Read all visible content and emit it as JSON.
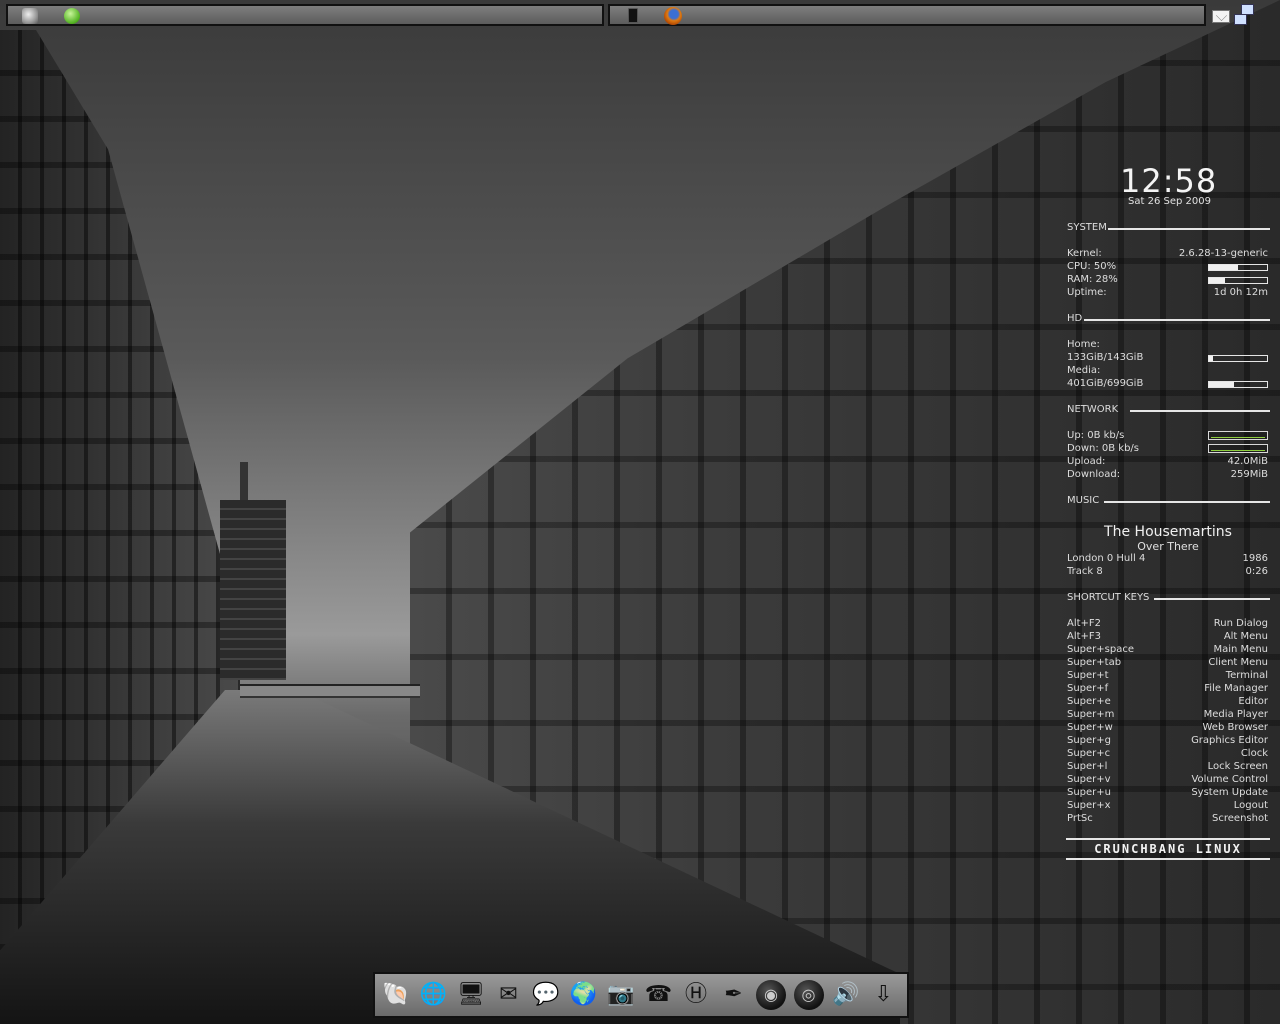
{
  "conky": {
    "clock": "12:58",
    "date": "Sat 26 Sep 2009",
    "system": {
      "header": "SYSTEM",
      "kernel_label": "Kernel:",
      "kernel_value": "2.6.28-13-generic",
      "cpu_label": "CPU: 50%",
      "cpu_fraction": 0.5,
      "ram_label": "RAM: 28%",
      "ram_fraction": 0.28,
      "uptime_label": "Uptime:",
      "uptime_value": "1d 0h 12m"
    },
    "hd": {
      "header": "HD",
      "home_label": "Home:",
      "home_usage": "133GiB/143GiB",
      "home_fraction": 0.07,
      "media_label": "Media:",
      "media_usage": "401GiB/699GiB",
      "media_fraction": 0.43
    },
    "network": {
      "header": "NETWORK",
      "up_label": "Up: 0B  kb/s",
      "down_label": "Down: 0B  kb/s",
      "upload_label": "Upload:",
      "upload_value": "42.0MiB",
      "download_label": "Download:",
      "download_value": "259MiB"
    },
    "music": {
      "header": "MUSIC",
      "artist": "The Housemartins",
      "song": "Over There",
      "album": "London 0 Hull 4",
      "year": "1986",
      "track": "Track 8",
      "time": "0:26"
    },
    "shortcuts": {
      "header": "SHORTCUT KEYS",
      "items": [
        {
          "key": "Alt+F2",
          "action": "Run Dialog"
        },
        {
          "key": "Alt+F3",
          "action": "Alt Menu"
        },
        {
          "key": "Super+space",
          "action": "Main Menu"
        },
        {
          "key": "Super+tab",
          "action": "Client Menu"
        },
        {
          "key": "Super+t",
          "action": "Terminal"
        },
        {
          "key": "Super+f",
          "action": "File Manager"
        },
        {
          "key": "Super+e",
          "action": "Editor"
        },
        {
          "key": "Super+m",
          "action": "Media Player"
        },
        {
          "key": "Super+w",
          "action": "Web Browser"
        },
        {
          "key": "Super+g",
          "action": "Graphics Editor"
        },
        {
          "key": "Super+c",
          "action": "Clock"
        },
        {
          "key": "Super+l",
          "action": "Lock Screen"
        },
        {
          "key": "Super+v",
          "action": "Volume Control"
        },
        {
          "key": "Super+u",
          "action": "System Update"
        },
        {
          "key": "Super+x",
          "action": "Logout"
        },
        {
          "key": "PrtSc",
          "action": "Screenshot"
        }
      ]
    },
    "brand": "CRUNCHBANG LINUX"
  },
  "panels": {
    "left_icons": [
      "menu-icon",
      "green-status-icon"
    ],
    "right_icons": [
      "terminal-icon",
      "firefox-icon"
    ],
    "tray_icons": [
      "mail-icon",
      "network-icon"
    ]
  },
  "dock": {
    "items": [
      {
        "name": "shell-launcher",
        "icon": "nautilus-shell-icon",
        "glyph": "🐚"
      },
      {
        "name": "web-browser",
        "icon": "globe-icon",
        "glyph": "🌐"
      },
      {
        "name": "terminal",
        "icon": "monitor-icon",
        "glyph": "🖥"
      },
      {
        "name": "mail",
        "icon": "envelope-icon",
        "glyph": "✉"
      },
      {
        "name": "chat",
        "icon": "chat-bubble-icon",
        "glyph": "💬"
      },
      {
        "name": "network-globe",
        "icon": "network-globe-icon",
        "glyph": "🌍"
      },
      {
        "name": "webcam",
        "icon": "webcam-icon",
        "glyph": "📷"
      },
      {
        "name": "phone",
        "icon": "phone-icon",
        "glyph": "☎"
      },
      {
        "name": "editor",
        "icon": "h-editor-icon",
        "glyph": "Ⓗ"
      },
      {
        "name": "pen-tool",
        "icon": "pen-icon",
        "glyph": "✒"
      },
      {
        "name": "disc-burner",
        "icon": "disc-icon",
        "glyph": "◉"
      },
      {
        "name": "media-player",
        "icon": "cd-icon",
        "glyph": "◎"
      },
      {
        "name": "speaker",
        "icon": "speaker-icon",
        "glyph": "🔊"
      },
      {
        "name": "downloads",
        "icon": "download-box-icon",
        "glyph": "⇩"
      }
    ]
  }
}
